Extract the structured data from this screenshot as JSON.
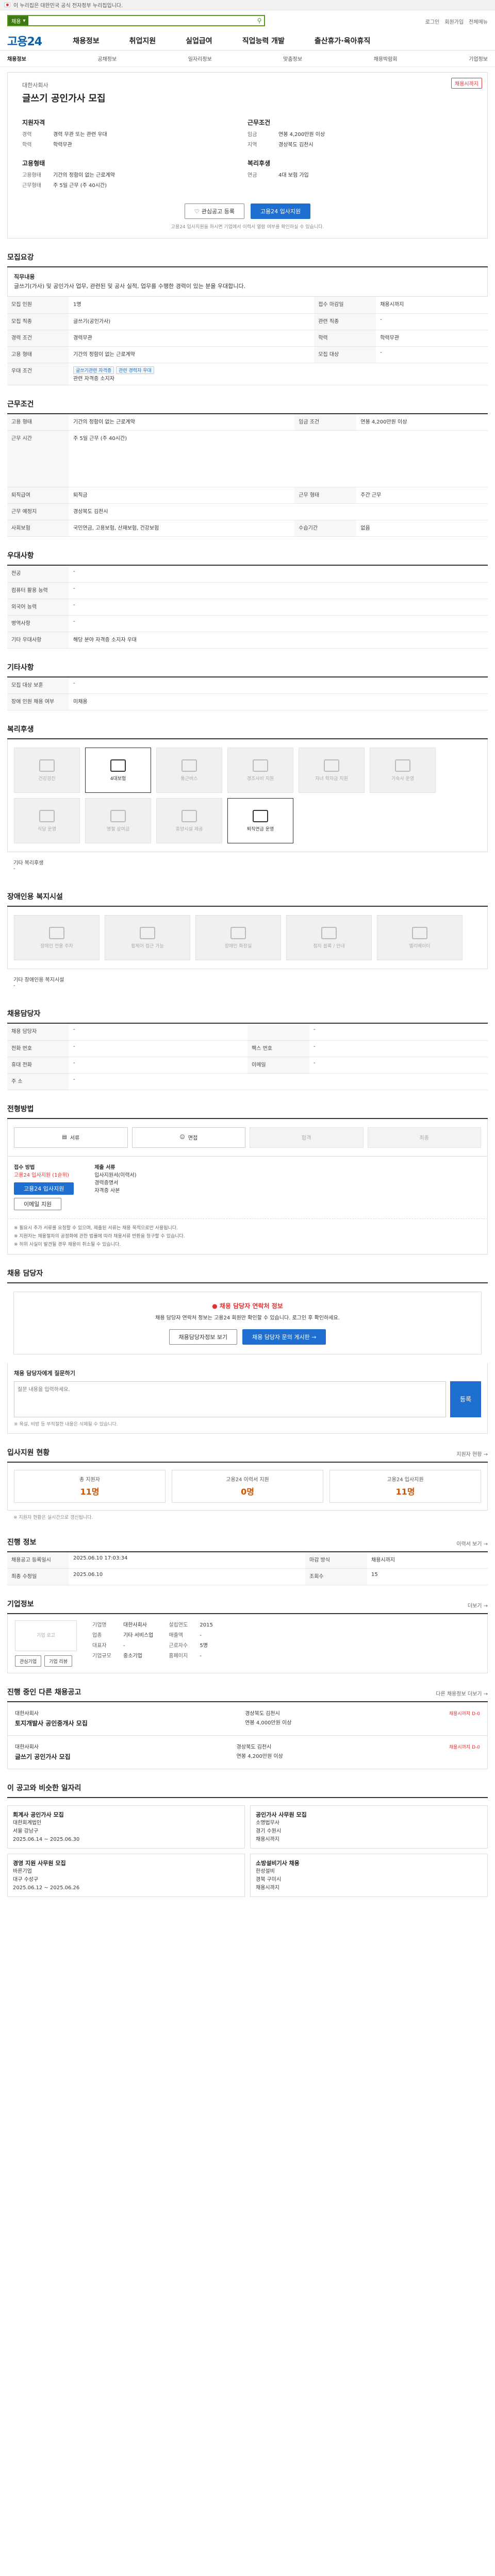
{
  "topbar": {
    "text": "이 누리집은 대한민국 공식 전자정부 누리집입니다."
  },
  "search": {
    "category": "채용",
    "placeholder": "",
    "util": [
      "로그인",
      "회원가입",
      "전체메뉴"
    ]
  },
  "logo": {
    "text": "고용24",
    "green": "24"
  },
  "gnb": [
    "채용정보",
    "취업지원",
    "실업급여",
    "직업능력 개발",
    "출산휴가·육아휴직"
  ],
  "subnav": [
    {
      "label": "채용정보",
      "on": true
    },
    {
      "label": "공채정보"
    },
    {
      "label": "일자리정보"
    },
    {
      "label": "맞춤정보"
    },
    {
      "label": "채용박람회"
    },
    {
      "label": "기업정보"
    }
  ],
  "hero": {
    "company": "대한사회사",
    "title": "글쓰기 공인가사 모집",
    "badge": "채용시까지",
    "left_h": "지원자격",
    "left": [
      [
        "경력",
        "경력 무관 또는 관련 우대"
      ],
      [
        "학력",
        "학력무관"
      ]
    ],
    "left2_h": "고용형태",
    "left2": [
      [
        "고용형태",
        "기간의 정함이 없는 근로계약"
      ],
      [
        "근무형태",
        "주 5일 근무 (주 40시간)"
      ]
    ],
    "right_h": "근무조건",
    "right": [
      [
        "임금",
        "연봉 4,200만원 이상"
      ],
      [
        "지역",
        "경상북도 김천시"
      ]
    ],
    "right2_h": "복리후생",
    "right2": [
      [
        "연금",
        "4대 보험 가입"
      ]
    ],
    "btn_scrap": "관심공고 등록",
    "btn_apply": "고용24 입사지원",
    "note": "고용24 입사지원을 하시면 기업에서 이력서 열람 여부를 확인하실 수 있습니다."
  },
  "recruit": {
    "title": "모집요강",
    "lead": "직무내용",
    "body": "글쓰기(가사) 및 공인가사 업무, 관련된 및 공사 실적, 업무를 수행한 경력이 있는 분을 우대합니다.",
    "rows": [
      [
        "모집 인원",
        "1명",
        "접수 마감일",
        "채용시까지"
      ],
      [
        "모집 직종",
        "글쓰기(공인가사)",
        "관련 직종",
        "-"
      ],
      [
        "경력 조건",
        "경력무관",
        "학력",
        "학력무관"
      ],
      [
        "고용 형태",
        "기간의 정함이 없는 근로계약",
        "모집 대상",
        "-"
      ],
      [
        "우대 조건",
        "관련 자격증 소지자"
      ]
    ],
    "tags": [
      "글쓰기관련 자격증",
      "관련 경력자 우대"
    ]
  },
  "work": {
    "title": "근무조건",
    "rows": [
      [
        "고용 형태",
        "기간의 정함이 없는 근로계약",
        "임금 조건",
        "연봉 4,200만원 이상"
      ],
      [
        "근무 시간",
        "주 5일 근무 (주 40시간)"
      ],
      [
        "퇴직급여",
        "퇴직금",
        "근무 형태",
        "주간 근무"
      ],
      [
        "근무 예정지",
        "경상북도 김천시",
        "",
        ""
      ],
      [
        "사회보험",
        "국민연금, 고용보험, 산재보험, 건강보험",
        "수습기간",
        "없음"
      ]
    ]
  },
  "etc": {
    "title": "우대사항",
    "rows": [
      [
        "전공",
        "-"
      ],
      [
        "컴퓨터 활용 능력",
        "-"
      ],
      [
        "외국어 능력",
        "-"
      ],
      [
        "병역사항",
        "-"
      ],
      [
        "기타 우대사항",
        "해당 분야 자격증 소지자 우대"
      ]
    ]
  },
  "other": {
    "title": "기타사항",
    "rows": [
      [
        "모집 대상 보훈",
        "-"
      ],
      [
        "장애 인원 채용 여부",
        "미채용"
      ]
    ]
  },
  "welfare": {
    "title": "복리후생",
    "items": [
      {
        "label": "건강검진",
        "on": false
      },
      {
        "label": "4대보험",
        "on": true
      },
      {
        "label": "통근버스",
        "on": false
      },
      {
        "label": "경조사비 지원",
        "on": false
      },
      {
        "label": "자녀 학자금 지원",
        "on": false
      },
      {
        "label": "기숙사 운영",
        "on": false
      },
      {
        "label": "식당 운영",
        "on": false
      },
      {
        "label": "명절 상여금",
        "on": false
      },
      {
        "label": "휴양시설 제공",
        "on": false
      },
      {
        "label": "퇴직연금 운영",
        "on": true
      }
    ],
    "etc_label": "기타 복리후생",
    "etc_value": "-"
  },
  "disabled": {
    "title": "장애인용 복지시설",
    "items": [
      "장애인 전용 주차",
      "휠체어 접근 가능",
      "장애인 화장실",
      "점자 블록 / 안내",
      "엘리베이터"
    ],
    "etc_label": "기타 장애인용 복지시설",
    "etc_value": "-"
  },
  "contact": {
    "title": "채용담당자",
    "rows": [
      [
        "채용 담당자",
        "-",
        "",
        "-"
      ],
      [
        "전화 번호",
        "-",
        "팩스 번호",
        "-"
      ],
      [
        "휴대 전화",
        "-",
        "이메일",
        "-"
      ],
      [
        "주 소",
        "-",
        "",
        ""
      ]
    ]
  },
  "process": {
    "title": "전형방법",
    "steps": [
      "서류",
      "면접",
      "합격",
      "최종"
    ],
    "submit_h": "접수 방법",
    "submit_v": "고용24 입사지원 (1순위)",
    "docs_h": "제출 서류",
    "docs": [
      "입사지원서(이력서)",
      "경력증명서",
      "자격증 사본"
    ],
    "apply_btn": "고용24 입사지원",
    "email_btn": "이메일 지원",
    "bullets": [
      "※ 필요시 추가 서류를 요청할 수 있으며, 제출된 서류는 채용 목적으로만 사용됩니다.",
      "※ 지원자는 채용절차의 공정화에 관한 법률에 따라 채용서류 반환을 청구할 수 있습니다.",
      "※ 허위 사실이 발견될 경우 채용이 취소될 수 있습니다."
    ]
  },
  "qa": {
    "title": "채용 담당자",
    "notice_h": "채용 담당자 연락처 정보",
    "notice": "채용 담당자 연락처 정보는 고용24 회원만 확인할 수 있습니다. 로그인 후 확인하세요.",
    "btn1": "채용담당자정보 보기",
    "btn2": "채용 담당자 문의 게시판 →",
    "q_label": "채용 담당자에게 질문하기",
    "placeholder": "질문 내용을 입력하세요.",
    "send": "등록",
    "warn": "※ 욕설, 비방 등 부적절한 내용은 삭제될 수 있습니다."
  },
  "stats": {
    "title": "입사지원 현황",
    "more": "지원자 현황 →",
    "items": [
      [
        "총 지원자",
        "11명"
      ],
      [
        "고용24 이력서 지원",
        "0명"
      ],
      [
        "고용24 입사지원",
        "11명"
      ]
    ],
    "note": "※ 지원자 현황은 실시간으로 갱신됩니다."
  },
  "process2": {
    "title": "진행 정보",
    "more": "이력서 보기 →",
    "rows": [
      [
        "채용공고 등록일시",
        "2025.06.10 17:03:34",
        "마감 방식",
        "채용시까지"
      ],
      [
        "최종 수정일",
        "2025.06.10",
        "조회수",
        "15"
      ]
    ]
  },
  "company": {
    "title": "기업정보",
    "more": "더보기 →",
    "logo": "기업 로고",
    "rows": [
      [
        "기업명",
        "대한사회사",
        "설립연도",
        "2015"
      ],
      [
        "업종",
        "기타 서비스업",
        "매출액",
        "-"
      ],
      [
        "대표자",
        "-",
        "근로자수",
        "5명"
      ],
      [
        "기업규모",
        "중소기업",
        "홈페이지",
        "-"
      ]
    ],
    "btns": [
      "관심기업",
      "기업 리뷰"
    ]
  },
  "jobs": {
    "title": "진행 중인 다른 채용공고",
    "more": "다른 채용정보 더보기 →",
    "items": [
      {
        "co": "대한사회사",
        "t": "토지개발사 공인중개사 모집",
        "loc": "경상북도 김천시",
        "pay": "연봉 4,000만원 이상",
        "dd": "채용시까지 D-0"
      },
      {
        "co": "대한사회사",
        "t": "글쓰기 공인가사 모집",
        "loc": "경상북도 김천시",
        "pay": "연봉 4,200만원 이상",
        "dd": "채용시까지 D-0"
      }
    ]
  },
  "rec": {
    "title": "이 공고와 비슷한 일자리",
    "items": [
      {
        "t": "회계사 공인가사 모집",
        "co": "대한회계법인",
        "loc": "서울 강남구",
        "dd": "2025.06.14 ~ 2025.06.30"
      },
      {
        "t": "공인가사 사무원 모집",
        "co": "소명법무사",
        "loc": "경기 수원시",
        "dd": "채용시까지"
      },
      {
        "t": "경영 지원 사무원 모집",
        "co": "바른기업",
        "loc": "대구 수성구",
        "dd": "2025.06.12 ~ 2025.06.26"
      },
      {
        "t": "소방설비기사 채용",
        "co": "한성설비",
        "loc": "경북 구미시",
        "dd": "채용시까지"
      }
    ]
  }
}
